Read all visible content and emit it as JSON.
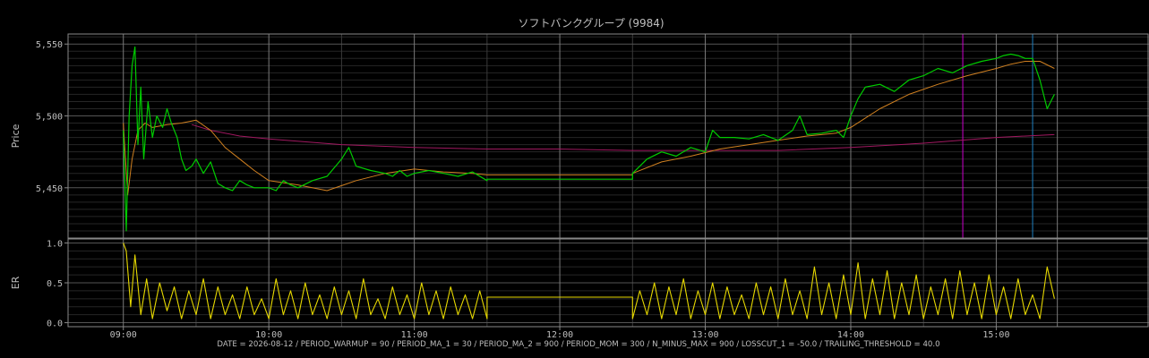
{
  "chart_data": {
    "type": "line",
    "title": "ソフトバンクグループ (9984)",
    "footer": "DATE = 2026-08-12 / PERIOD_WARMUP = 90 / PERIOD_MA_1 = 30 / PERIOD_MA_2 = 900 / PERIOD_MOM = 300 / N_MINUS_MAX = 900 / LOSSCUT_1 = -50.0 / TRAILING_THRESHOLD = 40.0",
    "x_ticks": [
      "09:00",
      "10:00",
      "11:00",
      "12:00",
      "13:00",
      "14:00",
      "15:00"
    ],
    "x_tick_values": [
      9.0,
      10.0,
      11.0,
      12.0,
      13.0,
      14.0,
      15.0
    ],
    "xlim": [
      8.62,
      16.05
    ],
    "grid": true,
    "colors": {
      "background": "#000000",
      "grid_major": "#555555",
      "grid_minor": "#262626",
      "axes": "#888888",
      "text": "#bfbfbf",
      "price": "#00cc00",
      "ma1": "#d08020",
      "ma2": "#a01860",
      "er": "#e6d800",
      "marker_magenta": "#cc00cc",
      "marker_blue": "#2080c0"
    },
    "price_panel": {
      "ylabel": "Price",
      "ylim": [
        5415,
        5557
      ],
      "y_ticks": [
        "5,450",
        "5,500",
        "5,550"
      ],
      "y_tick_values": [
        5450,
        5500,
        5550
      ],
      "series": [
        {
          "key": "price",
          "x": [
            9.0,
            9.02,
            9.04,
            9.06,
            9.08,
            9.1,
            9.12,
            9.14,
            9.17,
            9.2,
            9.23,
            9.27,
            9.3,
            9.33,
            9.37,
            9.4,
            9.43,
            9.47,
            9.5,
            9.55,
            9.6,
            9.65,
            9.7,
            9.75,
            9.8,
            9.85,
            9.9,
            10.0,
            10.05,
            10.1,
            10.15,
            10.2,
            10.3,
            10.4,
            10.5,
            10.55,
            10.6,
            10.7,
            10.8,
            10.85,
            10.9,
            10.95,
            11.0,
            11.1,
            11.2,
            11.3,
            11.4,
            11.5,
            11.5,
            12.5,
            12.5,
            12.55,
            12.6,
            12.7,
            12.8,
            12.9,
            13.0,
            13.05,
            13.1,
            13.2,
            13.3,
            13.4,
            13.5,
            13.6,
            13.65,
            13.7,
            13.8,
            13.9,
            13.95,
            14.0,
            14.05,
            14.1,
            14.2,
            14.3,
            14.4,
            14.5,
            14.6,
            14.7,
            14.8,
            14.9,
            15.0,
            15.05,
            15.1,
            15.15,
            15.2,
            15.25,
            15.3,
            15.35,
            15.4
          ],
          "y": [
            5490,
            5420,
            5500,
            5535,
            5548,
            5480,
            5520,
            5470,
            5510,
            5485,
            5500,
            5492,
            5505,
            5495,
            5485,
            5470,
            5462,
            5465,
            5470,
            5460,
            5468,
            5453,
            5450,
            5448,
            5455,
            5452,
            5450,
            5450,
            5448,
            5455,
            5452,
            5450,
            5455,
            5458,
            5470,
            5478,
            5465,
            5462,
            5460,
            5458,
            5462,
            5458,
            5460,
            5462,
            5460,
            5458,
            5461,
            5455,
            5456,
            5456,
            5460,
            5465,
            5470,
            5475,
            5472,
            5478,
            5475,
            5490,
            5485,
            5485,
            5484,
            5487,
            5483,
            5490,
            5500,
            5487,
            5488,
            5490,
            5485,
            5500,
            5512,
            5520,
            5522,
            5517,
            5525,
            5528,
            5533,
            5530,
            5535,
            5538,
            5540,
            5542,
            5543,
            5542,
            5540,
            5540,
            5525,
            5505,
            5515
          ]
        },
        {
          "key": "ma1",
          "x": [
            9.0,
            9.03,
            9.06,
            9.1,
            9.15,
            9.2,
            9.3,
            9.4,
            9.5,
            9.6,
            9.7,
            9.8,
            9.9,
            10.0,
            10.2,
            10.4,
            10.6,
            10.8,
            11.0,
            11.2,
            11.4,
            11.5,
            11.5,
            12.5,
            12.5,
            12.7,
            12.9,
            13.1,
            13.3,
            13.5,
            13.7,
            13.9,
            14.0,
            14.2,
            14.4,
            14.6,
            14.8,
            15.0,
            15.1,
            15.2,
            15.3,
            15.4
          ],
          "y": [
            5495,
            5445,
            5470,
            5490,
            5495,
            5492,
            5494,
            5495,
            5497,
            5490,
            5478,
            5470,
            5462,
            5455,
            5452,
            5448,
            5455,
            5460,
            5463,
            5461,
            5460,
            5459,
            5459,
            5459,
            5460,
            5468,
            5472,
            5477,
            5480,
            5483,
            5486,
            5488,
            5492,
            5505,
            5515,
            5522,
            5528,
            5533,
            5536,
            5538,
            5538,
            5533
          ]
        },
        {
          "key": "ma2",
          "x": [
            9.47,
            9.6,
            9.8,
            10.0,
            10.5,
            11.0,
            11.5,
            12.0,
            12.5,
            13.0,
            13.5,
            14.0,
            14.5,
            15.0,
            15.4
          ],
          "y": [
            5494,
            5490,
            5486,
            5484,
            5480,
            5478,
            5477,
            5477,
            5476,
            5476,
            5476,
            5478,
            5481,
            5485,
            5487
          ]
        }
      ],
      "markers": [
        {
          "key": "marker_magenta",
          "x": 14.77
        },
        {
          "key": "marker_blue",
          "x": 15.25
        }
      ]
    },
    "er_panel": {
      "ylabel": "ER",
      "ylim": [
        -0.05,
        1.05
      ],
      "y_ticks": [
        "0.0",
        "0.5",
        "1.0"
      ],
      "y_tick_values": [
        0.0,
        0.5,
        1.0
      ],
      "series": [
        {
          "key": "er",
          "x": [
            9.0,
            9.02,
            9.05,
            9.08,
            9.12,
            9.16,
            9.2,
            9.25,
            9.3,
            9.35,
            9.4,
            9.45,
            9.5,
            9.55,
            9.6,
            9.65,
            9.7,
            9.75,
            9.8,
            9.85,
            9.9,
            9.95,
            10.0,
            10.05,
            10.1,
            10.15,
            10.2,
            10.25,
            10.3,
            10.35,
            10.4,
            10.45,
            10.5,
            10.55,
            10.6,
            10.65,
            10.7,
            10.75,
            10.8,
            10.85,
            10.9,
            10.95,
            11.0,
            11.05,
            11.1,
            11.15,
            11.2,
            11.25,
            11.3,
            11.35,
            11.4,
            11.45,
            11.5,
            11.5,
            12.5,
            12.5,
            12.55,
            12.6,
            12.65,
            12.7,
            12.75,
            12.8,
            12.85,
            12.9,
            12.95,
            13.0,
            13.05,
            13.1,
            13.15,
            13.2,
            13.25,
            13.3,
            13.35,
            13.4,
            13.45,
            13.5,
            13.55,
            13.6,
            13.65,
            13.7,
            13.75,
            13.8,
            13.85,
            13.9,
            13.95,
            14.0,
            14.05,
            14.1,
            14.15,
            14.2,
            14.25,
            14.3,
            14.35,
            14.4,
            14.45,
            14.5,
            14.55,
            14.6,
            14.65,
            14.7,
            14.75,
            14.8,
            14.85,
            14.9,
            14.95,
            15.0,
            15.05,
            15.1,
            15.15,
            15.2,
            15.25,
            15.3,
            15.35,
            15.4
          ],
          "y": [
            1.0,
            0.9,
            0.2,
            0.85,
            0.1,
            0.55,
            0.05,
            0.5,
            0.15,
            0.45,
            0.05,
            0.4,
            0.1,
            0.55,
            0.05,
            0.45,
            0.1,
            0.35,
            0.05,
            0.45,
            0.1,
            0.3,
            0.05,
            0.55,
            0.1,
            0.4,
            0.05,
            0.5,
            0.1,
            0.35,
            0.05,
            0.45,
            0.1,
            0.4,
            0.05,
            0.55,
            0.1,
            0.3,
            0.05,
            0.45,
            0.1,
            0.35,
            0.05,
            0.5,
            0.1,
            0.4,
            0.05,
            0.45,
            0.1,
            0.35,
            0.05,
            0.4,
            0.05,
            0.32,
            0.32,
            0.05,
            0.4,
            0.1,
            0.5,
            0.05,
            0.45,
            0.1,
            0.55,
            0.05,
            0.4,
            0.1,
            0.5,
            0.05,
            0.45,
            0.1,
            0.35,
            0.05,
            0.5,
            0.1,
            0.45,
            0.05,
            0.55,
            0.1,
            0.4,
            0.05,
            0.7,
            0.1,
            0.5,
            0.05,
            0.6,
            0.1,
            0.75,
            0.05,
            0.55,
            0.1,
            0.65,
            0.05,
            0.5,
            0.1,
            0.6,
            0.05,
            0.45,
            0.1,
            0.55,
            0.05,
            0.65,
            0.1,
            0.5,
            0.05,
            0.6,
            0.1,
            0.45,
            0.05,
            0.55,
            0.1,
            0.35,
            0.05,
            0.7,
            0.3
          ]
        }
      ]
    }
  }
}
